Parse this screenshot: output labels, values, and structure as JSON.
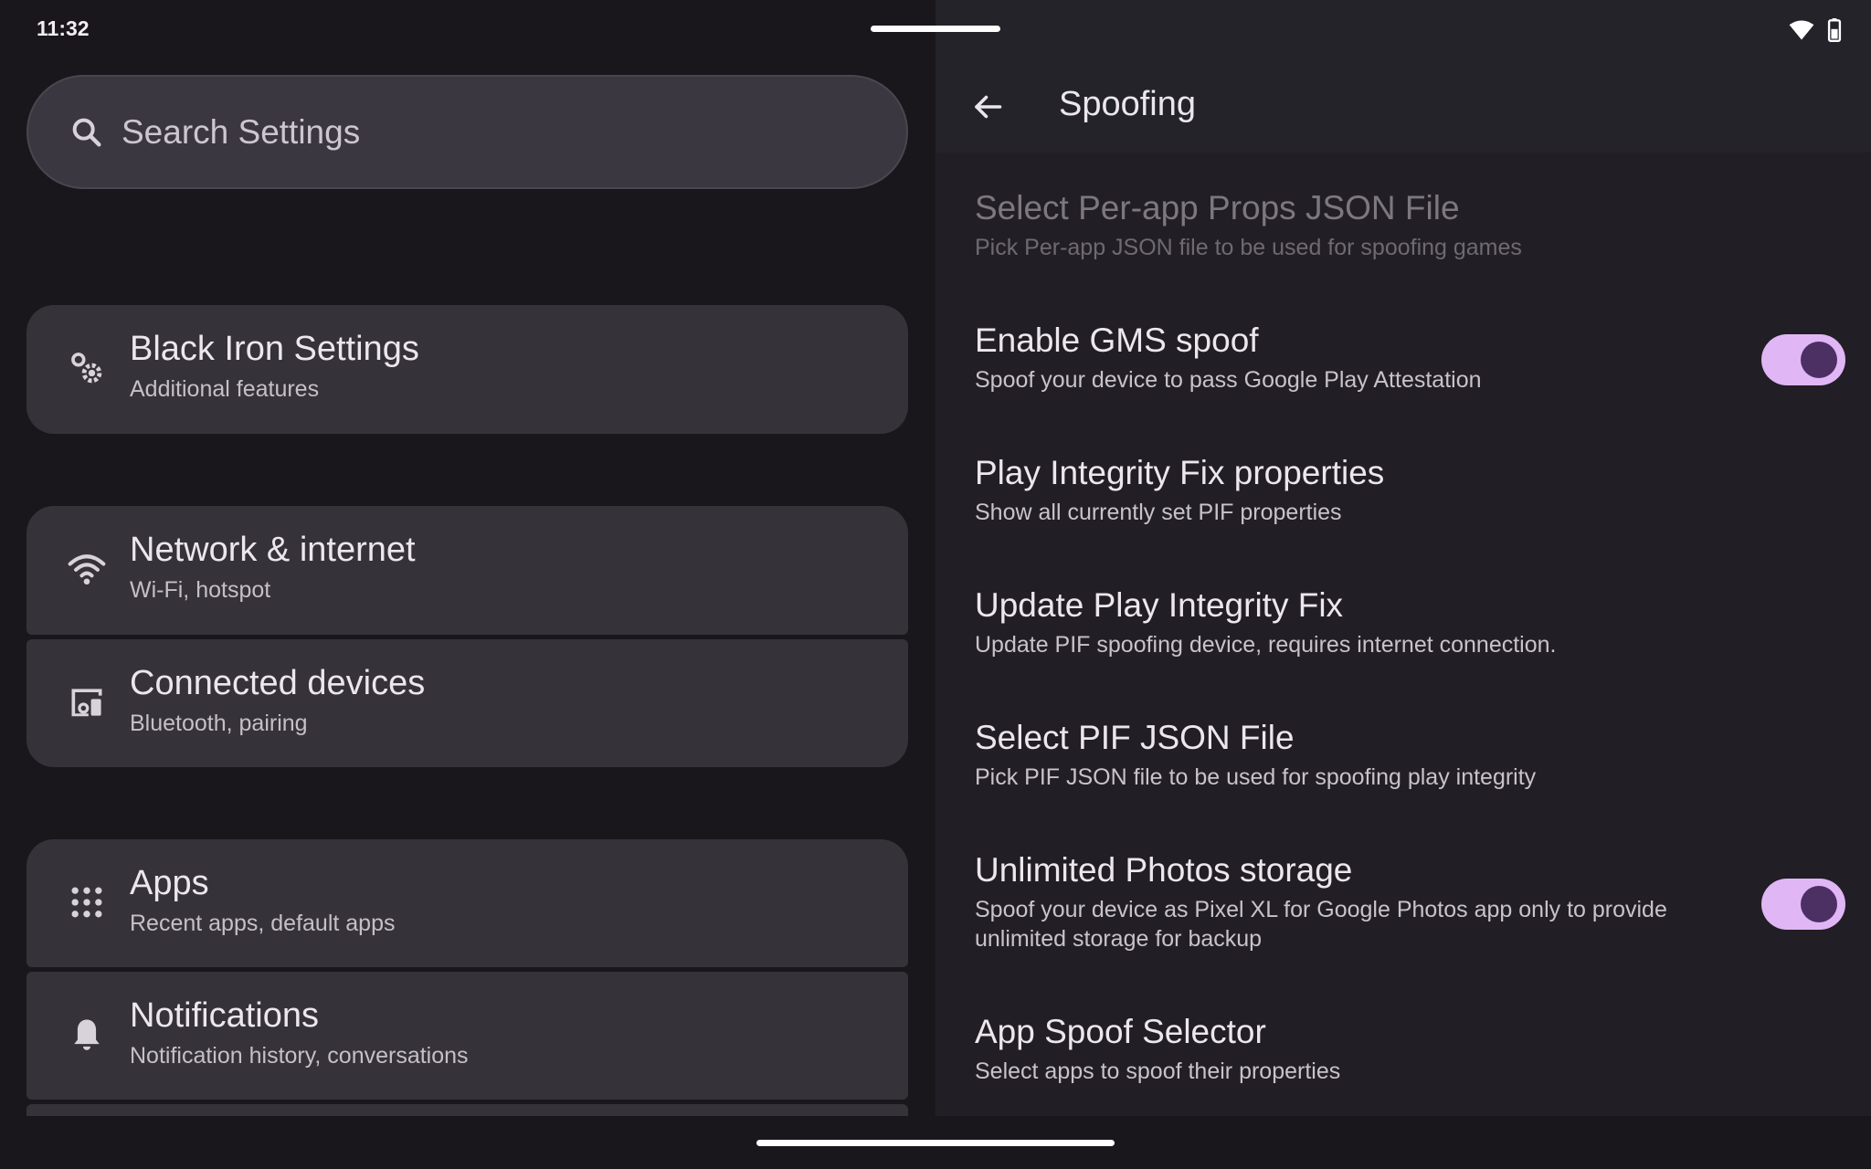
{
  "status_bar": {
    "time": "11:32"
  },
  "left_pane": {
    "search": {
      "placeholder": "Search Settings"
    },
    "items": [
      {
        "title": "Black Iron Settings",
        "subtitle": "Additional features",
        "icon": "gear-cog-icon"
      },
      {
        "title": "Network & internet",
        "subtitle": "Wi-Fi, hotspot",
        "icon": "wifi-icon"
      },
      {
        "title": "Connected devices",
        "subtitle": "Bluetooth, pairing",
        "icon": "devices-icon"
      },
      {
        "title": "Apps",
        "subtitle": "Recent apps, default apps",
        "icon": "apps-grid-icon"
      },
      {
        "title": "Notifications",
        "subtitle": "Notification history, conversations",
        "icon": "bell-icon"
      }
    ]
  },
  "right_pane": {
    "title": "Spoofing",
    "prefs": [
      {
        "title": "Select Per-app Props JSON File",
        "subtitle": "Pick Per-app JSON file to be used for spoofing games",
        "enabled": false
      },
      {
        "title": "Enable GMS spoof",
        "subtitle": "Spoof your device to pass Google Play Attestation",
        "toggle": true
      },
      {
        "title": "Play Integrity Fix properties",
        "subtitle": "Show all currently set PIF properties"
      },
      {
        "title": "Update Play Integrity Fix",
        "subtitle": "Update PIF spoofing device, requires internet connection."
      },
      {
        "title": "Select PIF JSON File",
        "subtitle": "Pick PIF JSON file to be used for spoofing play integrity"
      },
      {
        "title": "Unlimited Photos storage",
        "subtitle": "Spoof your device as Pixel XL for Google Photos app only to provide unlimited storage for backup",
        "toggle": true
      },
      {
        "title": "App Spoof Selector",
        "subtitle": "Select apps to spoof their properties"
      }
    ]
  },
  "colors": {
    "accent_track": "#e0b6f5",
    "accent_thumb": "#4c2f63",
    "card_bg": "#35323a"
  }
}
